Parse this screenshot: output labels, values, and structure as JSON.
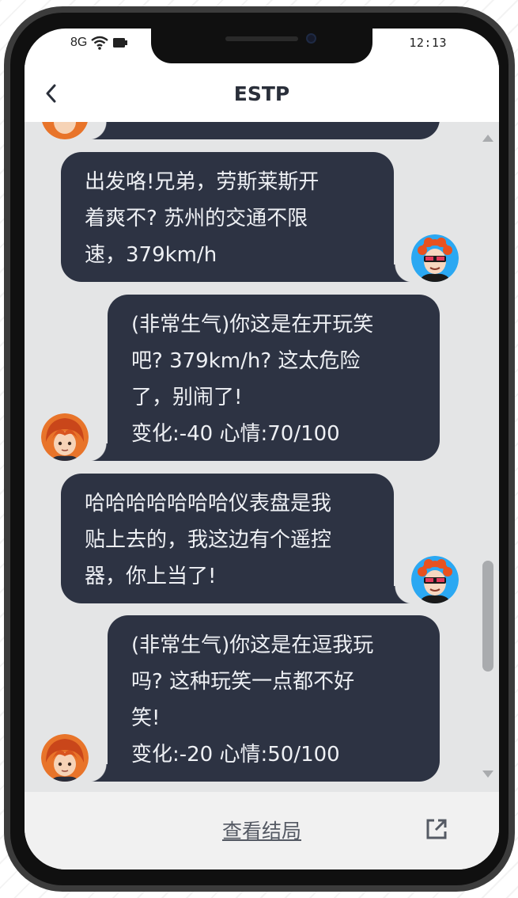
{
  "status_bar": {
    "network": "8G",
    "time": "12:13"
  },
  "header": {
    "title": "ESTP",
    "back_icon": "chevron-left-icon"
  },
  "messages": [
    {
      "side": "right",
      "avatar": "user-avatar-sunglasses",
      "text": "出发咯!兄弟，劳斯莱斯开\n着爽不? 苏州的交通不限\n速，379km/h"
    },
    {
      "side": "left",
      "avatar": "estp-avatar-orange-hair",
      "text": "(非常生气)你这是在开玩笑\n吧? 379km/h? 这太危险\n了，别闹了!\n变化:-40 心情:70/100"
    },
    {
      "side": "right",
      "avatar": "user-avatar-sunglasses",
      "text": "哈哈哈哈哈哈哈仪表盘是我\n贴上去的，我这边有个遥控\n器，你上当了!"
    },
    {
      "side": "left",
      "avatar": "estp-avatar-orange-hair",
      "text": "(非常生气)你这是在逗我玩\n吗? 这种玩笑一点都不好\n笑!\n变化:-20 心情:50/100"
    }
  ],
  "footer": {
    "end_link": "查看结局",
    "share_icon": "external-link-icon"
  },
  "colors": {
    "bubble": "#2d3343",
    "bubble_text": "#eef0f4",
    "chat_bg": "#e4e5e6",
    "user_avatar_bg": "#2ba8f2",
    "bot_avatar_bg": "#e8742a"
  }
}
